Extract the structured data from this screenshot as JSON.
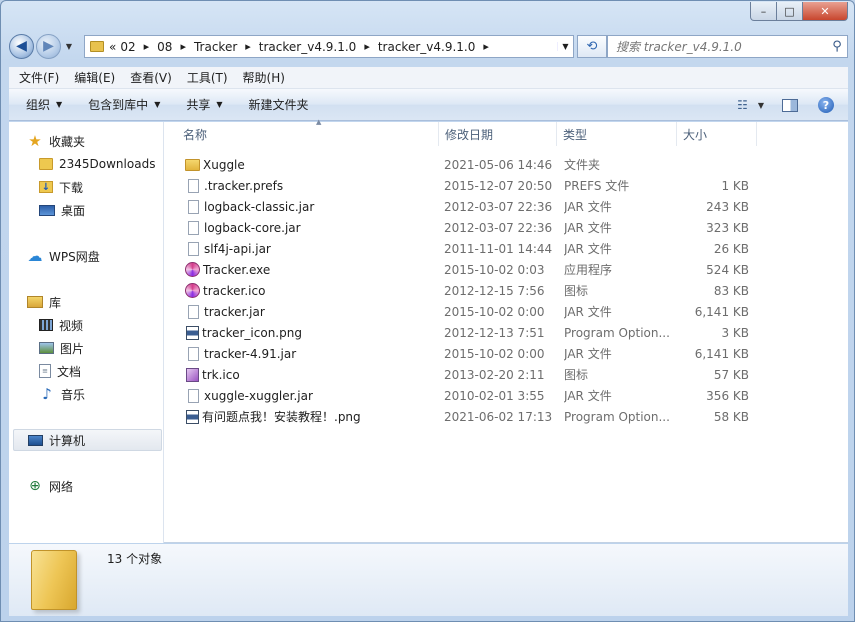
{
  "caption": {
    "min": "–",
    "max": "□",
    "close": "✕"
  },
  "address": {
    "overflow": "«",
    "crumbs": [
      "02",
      "08",
      "Tracker",
      "tracker_v4.9.1.0",
      "tracker_v4.9.1.0"
    ]
  },
  "search": {
    "placeholder": "搜索 tracker_v4.9.1.0"
  },
  "menu": [
    "文件(F)",
    "编辑(E)",
    "查看(V)",
    "工具(T)",
    "帮助(H)"
  ],
  "toolbar": {
    "organize": "组织",
    "include_library": "包含到库中",
    "share": "共享",
    "new_folder": "新建文件夹"
  },
  "sidebar": {
    "favorites": "收藏夹",
    "downloads2345": "2345Downloads",
    "downloads": "下载",
    "desktop": "桌面",
    "wps": "WPS网盘",
    "libraries": "库",
    "videos": "视频",
    "pictures": "图片",
    "documents": "文档",
    "music": "音乐",
    "computer": "计算机",
    "network": "网络"
  },
  "columns": {
    "name": "名称",
    "date": "修改日期",
    "type": "类型",
    "size": "大小"
  },
  "files": [
    {
      "name": "Xuggle",
      "date": "2021-05-06 14:46",
      "type": "文件夹",
      "size": "",
      "icon": "folder-icon"
    },
    {
      "name": ".tracker.prefs",
      "date": "2015-12-07 20:50",
      "type": "PREFS 文件",
      "size": "1 KB",
      "icon": "file-icon"
    },
    {
      "name": "logback-classic.jar",
      "date": "2012-03-07 22:36",
      "type": "JAR 文件",
      "size": "243 KB",
      "icon": "file-icon"
    },
    {
      "name": "logback-core.jar",
      "date": "2012-03-07 22:36",
      "type": "JAR 文件",
      "size": "323 KB",
      "icon": "file-icon"
    },
    {
      "name": "slf4j-api.jar",
      "date": "2011-11-01 14:44",
      "type": "JAR 文件",
      "size": "26 KB",
      "icon": "file-icon"
    },
    {
      "name": "Tracker.exe",
      "date": "2015-10-02 0:03",
      "type": "应用程序",
      "size": "524 KB",
      "icon": "tracker-app-icon"
    },
    {
      "name": "tracker.ico",
      "date": "2012-12-15 7:56",
      "type": "图标",
      "size": "83 KB",
      "icon": "tracker-app-icon"
    },
    {
      "name": "tracker.jar",
      "date": "2015-10-02 0:00",
      "type": "JAR 文件",
      "size": "6,141 KB",
      "icon": "file-icon"
    },
    {
      "name": "tracker_icon.png",
      "date": "2012-12-13 7:51",
      "type": "Program Option...",
      "size": "3 KB",
      "icon": "image-file-icon"
    },
    {
      "name": "tracker-4.91.jar",
      "date": "2015-10-02 0:00",
      "type": "JAR 文件",
      "size": "6,141 KB",
      "icon": "file-icon"
    },
    {
      "name": "trk.ico",
      "date": "2013-02-20 2:11",
      "type": "图标",
      "size": "57 KB",
      "icon": "small-ico-icon"
    },
    {
      "name": "xuggle-xuggler.jar",
      "date": "2010-02-01 3:55",
      "type": "JAR 文件",
      "size": "356 KB",
      "icon": "file-icon"
    },
    {
      "name": "有问题点我！安装教程！.png",
      "date": "2021-06-02 17:13",
      "type": "Program Option...",
      "size": "58 KB",
      "icon": "image-file-icon"
    }
  ],
  "status": {
    "count": "13 个对象"
  }
}
